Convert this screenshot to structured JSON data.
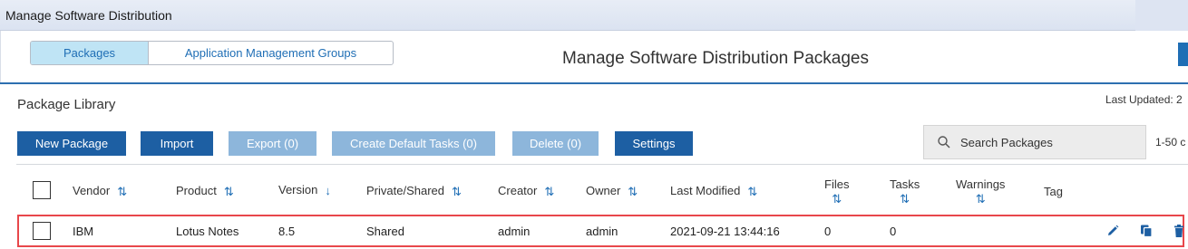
{
  "window": {
    "title": "Manage Software Distribution"
  },
  "tabs": [
    {
      "label": "Packages",
      "active": true
    },
    {
      "label": "Application Management Groups",
      "active": false
    }
  ],
  "page_title": "Manage Software Distribution Packages",
  "library": {
    "title": "Package Library",
    "last_updated": "Last Updated: 2"
  },
  "toolbar": {
    "new_package": "New Package",
    "import": "Import",
    "export": "Export (0)",
    "create_default_tasks": "Create Default Tasks (0)",
    "delete": "Delete (0)",
    "settings": "Settings"
  },
  "search": {
    "placeholder": "Search Packages"
  },
  "paging": "1-50 c",
  "columns": {
    "vendor": "Vendor",
    "product": "Product",
    "version": "Version",
    "private_shared": "Private/Shared",
    "creator": "Creator",
    "owner": "Owner",
    "last_modified": "Last Modified",
    "files": "Files",
    "tasks": "Tasks",
    "warnings": "Warnings",
    "tag": "Tag"
  },
  "rows": [
    {
      "vendor": "IBM",
      "product": "Lotus Notes",
      "version": "8.5",
      "private_shared": "Shared",
      "creator": "admin",
      "owner": "admin",
      "last_modified": "2021-09-21 13:44:16",
      "files": "0",
      "tasks": "0",
      "warnings": "",
      "tag": "",
      "highlighted": true
    }
  ],
  "icons": {
    "sort": "sort-arrows-icon",
    "sort_desc": "sort-down-icon",
    "search": "search-icon",
    "edit": "pencil-icon",
    "copy": "copy-icon",
    "delete": "trash-icon"
  },
  "colors": {
    "primary_button": "#1d5fa3",
    "disabled_button": "#8db6db",
    "active_tab": "#bfe4f5",
    "link_blue": "#1f6eb5",
    "highlight_border": "#e8474b"
  }
}
